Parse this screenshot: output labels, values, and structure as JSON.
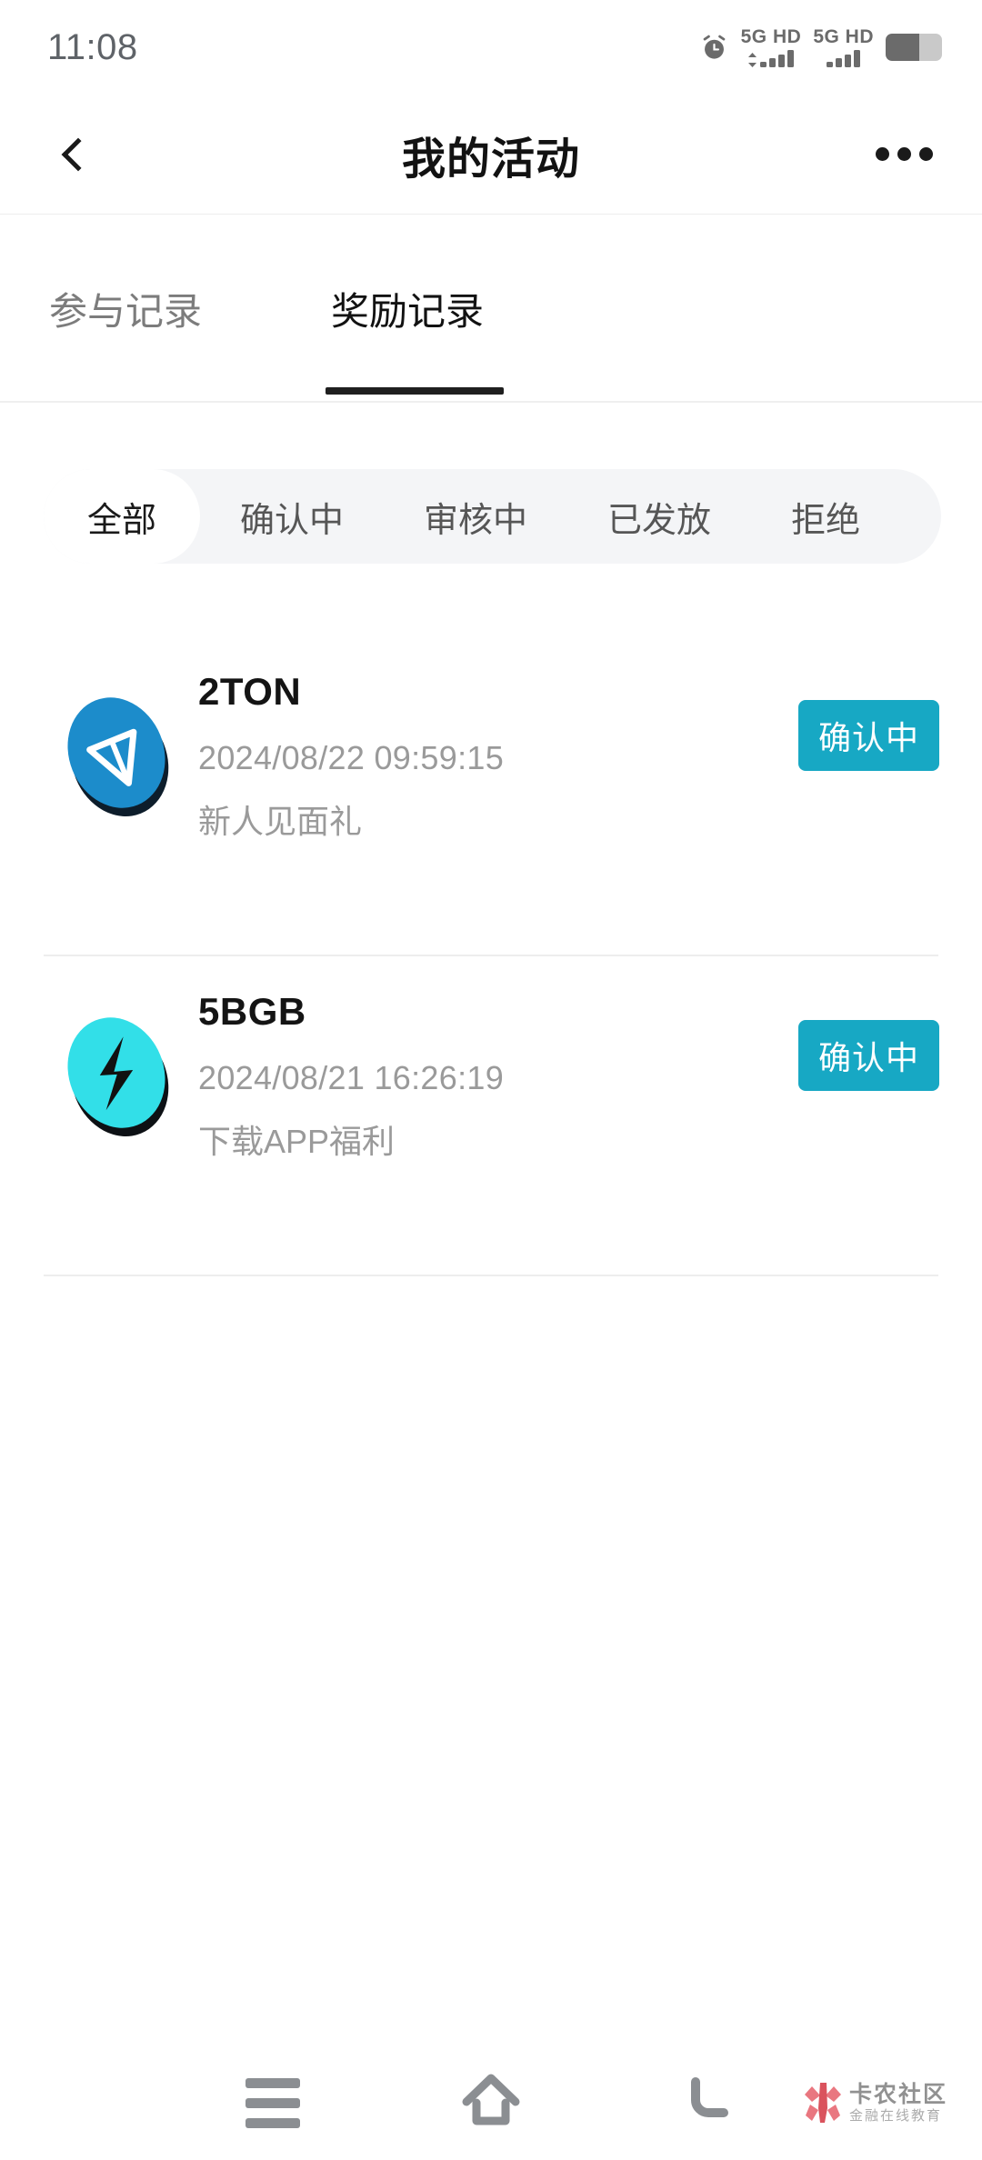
{
  "status_bar": {
    "time": "11:08",
    "alarm_icon": "alarm-clock-icon",
    "sim1_network": "5G HD",
    "sim2_network": "5G HD",
    "battery_icon": "battery-icon"
  },
  "header": {
    "back_icon": "chevron-left-icon",
    "title": "我的活动",
    "more_icon": "more-options-icon"
  },
  "tabs": [
    {
      "label": "参与记录",
      "active": false
    },
    {
      "label": "奖励记录",
      "active": true
    }
  ],
  "filters": [
    {
      "label": "全部",
      "selected": true
    },
    {
      "label": "确认中",
      "selected": false
    },
    {
      "label": "审核中",
      "selected": false
    },
    {
      "label": "已发放",
      "selected": false
    },
    {
      "label": "拒绝",
      "selected": false
    }
  ],
  "rewards": [
    {
      "icon": "ton-coin-icon",
      "icon_color": "#1c8ccb",
      "amount": "2TON",
      "time": "2024/08/22 09:59:15",
      "description": "新人见面礼",
      "status": "确认中",
      "status_color": "#17a8c4"
    },
    {
      "icon": "bgb-coin-icon",
      "icon_color": "#32dfe8",
      "amount": "5BGB",
      "time": "2024/08/21 16:26:19",
      "description": "下载APP福利",
      "status": "确认中",
      "status_color": "#17a8c4"
    }
  ],
  "nav_bar": {
    "recents_icon": "recents-menu-icon",
    "home_icon": "home-icon",
    "back_icon": "back-arrow-icon",
    "watermark_title": "卡农社区",
    "watermark_subtitle": "金融在线教育"
  }
}
